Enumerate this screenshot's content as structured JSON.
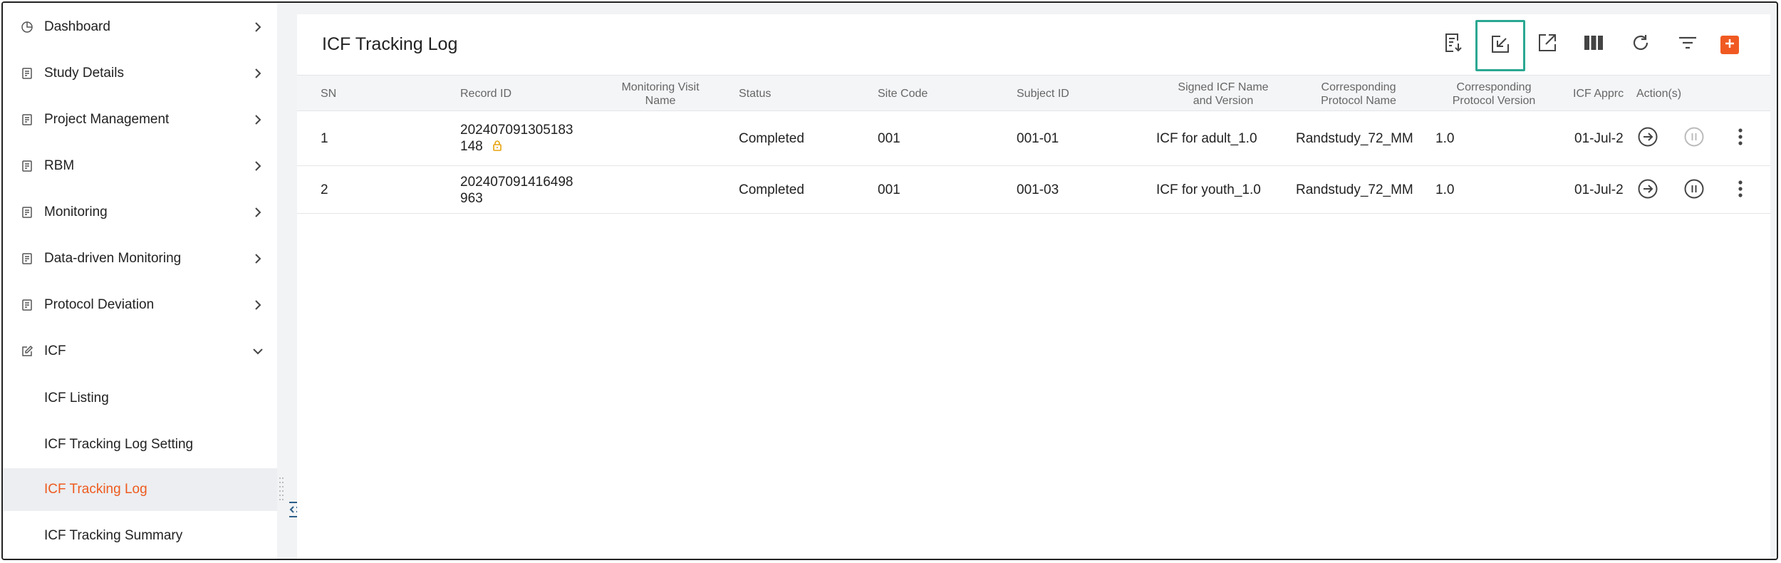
{
  "sidebar": {
    "items": [
      {
        "label": "Dashboard",
        "icon": "pie-chart-icon",
        "expanded": false
      },
      {
        "label": "Study Details",
        "icon": "document-icon",
        "expanded": false
      },
      {
        "label": "Project Management",
        "icon": "document-icon",
        "expanded": false
      },
      {
        "label": "RBM",
        "icon": "document-icon",
        "expanded": false
      },
      {
        "label": "Monitoring",
        "icon": "document-icon",
        "expanded": false
      },
      {
        "label": "Data-driven Monitoring",
        "icon": "document-icon",
        "expanded": false
      },
      {
        "label": "Protocol Deviation",
        "icon": "document-icon",
        "expanded": false
      },
      {
        "label": "ICF",
        "icon": "edit-icon",
        "expanded": true
      }
    ],
    "icf_children": [
      {
        "label": "ICF Listing",
        "active": false
      },
      {
        "label": "ICF Tracking Log Setting",
        "active": false
      },
      {
        "label": "ICF Tracking Log",
        "active": true
      },
      {
        "label": "ICF Tracking Summary",
        "active": false
      }
    ]
  },
  "page": {
    "title": "ICF Tracking Log"
  },
  "toolbar": {
    "buttons": [
      "export-report-icon",
      "import-icon",
      "open-external-icon",
      "columns-icon",
      "refresh-icon",
      "filter-icon",
      "add-icon"
    ],
    "highlighted": "import-icon"
  },
  "table": {
    "headers": {
      "sn": "SN",
      "record_id": "Record ID",
      "monitoring_visit_1": "Monitoring Visit",
      "monitoring_visit_2": "Name",
      "status": "Status",
      "site_code": "Site Code",
      "subject_id": "Subject ID",
      "signed_icf_1": "Signed ICF Name",
      "signed_icf_2": "and Version",
      "protocol_name_1": "Corresponding",
      "protocol_name_2": "Protocol Name",
      "protocol_version_1": "Corresponding",
      "protocol_version_2": "Protocol Version",
      "icf_approval": "ICF Apprc",
      "actions": "Action(s)"
    },
    "rows": [
      {
        "sn": "1",
        "record_id_1": "202407091305183",
        "record_id_2": "148",
        "locked": true,
        "monitoring_visit": "",
        "status": "Completed",
        "site_code": "001",
        "subject_id": "001-01",
        "signed_icf": "ICF for adult_1.0",
        "protocol_name": "Randstudy_72_MM",
        "protocol_version": "1.0",
        "icf_approval": "01-Jul-2",
        "pause_enabled": false
      },
      {
        "sn": "2",
        "record_id_1": "202407091416498",
        "record_id_2": "963",
        "locked": false,
        "monitoring_visit": "",
        "status": "Completed",
        "site_code": "001",
        "subject_id": "001-03",
        "signed_icf": "ICF for youth_1.0",
        "protocol_name": "Randstudy_72_MM",
        "protocol_version": "1.0",
        "icf_approval": "01-Jul-2",
        "pause_enabled": true
      }
    ]
  },
  "colors": {
    "accent": "#ee5a1e",
    "highlight_border": "#2aa892",
    "lock": "#e7a20a"
  }
}
